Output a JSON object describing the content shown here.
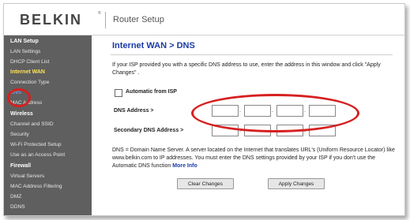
{
  "header": {
    "logo": "BELKIN",
    "logo_tm": "®",
    "title": "Router Setup"
  },
  "sidebar": {
    "items": [
      {
        "label": "LAN Setup",
        "type": "section"
      },
      {
        "label": "LAN Settings",
        "type": "item"
      },
      {
        "label": "DHCP Client List",
        "type": "item"
      },
      {
        "label": "Internet WAN",
        "type": "section-active"
      },
      {
        "label": "Connection Type",
        "type": "item"
      },
      {
        "label": "DNS",
        "type": "item-current"
      },
      {
        "label": "MAC Address",
        "type": "item"
      },
      {
        "label": "Wireless",
        "type": "section"
      },
      {
        "label": "Channel and SSID",
        "type": "item"
      },
      {
        "label": "Security",
        "type": "item"
      },
      {
        "label": "Wi-Fi Protected Setup",
        "type": "item"
      },
      {
        "label": "Use as an Access Point",
        "type": "item"
      },
      {
        "label": "Firewall",
        "type": "section"
      },
      {
        "label": "Virtual Servers",
        "type": "item"
      },
      {
        "label": "MAC Address Filtering",
        "type": "item"
      },
      {
        "label": "DMZ",
        "type": "item"
      },
      {
        "label": "DDNS",
        "type": "item"
      }
    ]
  },
  "main": {
    "title": "Internet WAN > DNS",
    "intro": "If your ISP provided you with a specific DNS address to use, enter the address in this window and click \"Apply Changes\" .",
    "auto_label": "Automatic from ISP",
    "dns_label": "DNS Address >",
    "secondary_label": "Secondary DNS Address >",
    "dns_octets": [
      "",
      "",
      "",
      ""
    ],
    "secondary_octets": [
      "",
      "",
      "",
      ""
    ],
    "octet_separator": ".",
    "description": "DNS = Domain Name Server. A server located on the Internet that translates URL's (Uniform Resource Locator) like www.belkin.com to IP addresses. You must enter the DNS settings provided by your ISP if you don't use the Automatic DNS function",
    "more_info": "More Info",
    "clear_button": "Clear Changes",
    "apply_button": "Apply Changes"
  },
  "colors": {
    "sidebar_bg": "#5f5f5f",
    "title_blue": "#1a3aa8",
    "active_yellow": "#ffe35a",
    "highlight_red": "#d62020"
  }
}
